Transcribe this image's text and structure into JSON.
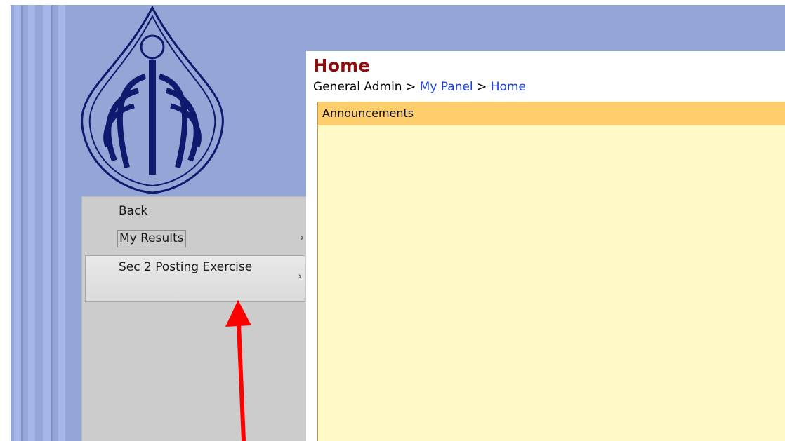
{
  "menu": {
    "items": [
      {
        "label": "Back"
      },
      {
        "label": "My Results",
        "submenu_icon": "›"
      },
      {
        "label": "Sec 2 Posting Exercise",
        "submenu_icon": "›"
      }
    ]
  },
  "main": {
    "title": "Home",
    "breadcrumb": {
      "root": "General Admin",
      "sep": ">",
      "panel": "My Panel",
      "current": "Home"
    },
    "announcements": {
      "header": "Announcements"
    }
  },
  "colors": {
    "background": "#93a6d6",
    "title": "#8b0d0d",
    "link": "#1a3ee0",
    "panel_header": "#fecd6c",
    "panel_body": "#fffac8",
    "menu": "#cccccc",
    "annotation_arrow": "#ff0000",
    "logo": "#0d1a6e"
  },
  "icons": {
    "logo": "leaf-logo-icon",
    "chevron": "chevron-right-icon",
    "annotation": "red-arrow-icon"
  }
}
